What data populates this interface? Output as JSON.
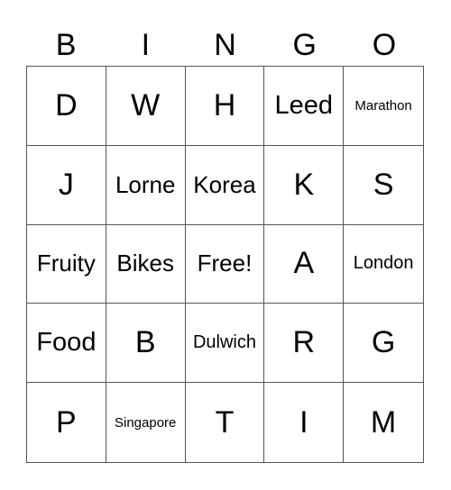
{
  "header": [
    "B",
    "I",
    "N",
    "G",
    "O"
  ],
  "cells": [
    {
      "text": "D",
      "size": "s-xl"
    },
    {
      "text": "W",
      "size": "s-xl"
    },
    {
      "text": "H",
      "size": "s-xl"
    },
    {
      "text": "Leed",
      "size": "s-l"
    },
    {
      "text": "Marathon",
      "size": "s-xxs"
    },
    {
      "text": "J",
      "size": "s-xl"
    },
    {
      "text": "Lorne",
      "size": "s-m"
    },
    {
      "text": "Korea",
      "size": "s-m"
    },
    {
      "text": "K",
      "size": "s-xl"
    },
    {
      "text": "S",
      "size": "s-xl"
    },
    {
      "text": "Fruity",
      "size": "s-m"
    },
    {
      "text": "Bikes",
      "size": "s-m"
    },
    {
      "text": "Free!",
      "size": "s-m"
    },
    {
      "text": "A",
      "size": "s-xl"
    },
    {
      "text": "London",
      "size": "s-s"
    },
    {
      "text": "Food",
      "size": "s-l"
    },
    {
      "text": "B",
      "size": "s-xl"
    },
    {
      "text": "Dulwich",
      "size": "s-s"
    },
    {
      "text": "R",
      "size": "s-xl"
    },
    {
      "text": "G",
      "size": "s-xl"
    },
    {
      "text": "P",
      "size": "s-xl"
    },
    {
      "text": "Singapore",
      "size": "s-xxs"
    },
    {
      "text": "T",
      "size": "s-xl"
    },
    {
      "text": "I",
      "size": "s-xl"
    },
    {
      "text": "M",
      "size": "s-xl"
    }
  ]
}
